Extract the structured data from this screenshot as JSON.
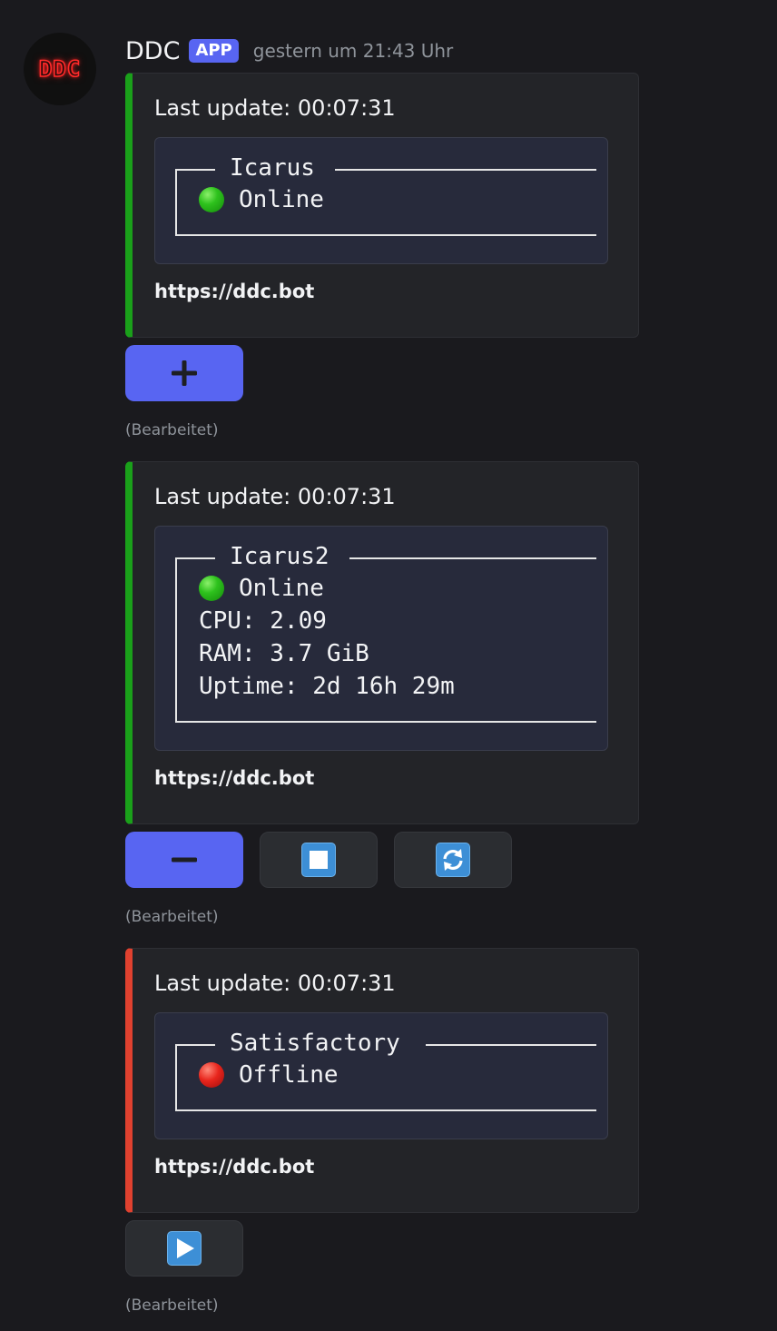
{
  "message": {
    "username": "DDC",
    "badge": "APP",
    "timestamp": "gestern um 21:43 Uhr",
    "avatar_text": "DDC"
  },
  "embeds": [
    {
      "title": "Last update: 00:07:31",
      "server_name": "Icarus",
      "status": "Online",
      "status_color": "#2ec21d",
      "stats": [],
      "footer": "https://ddc.bot",
      "accent_color": "#1aa01a",
      "buttons": [
        {
          "icon": "plus-icon",
          "style": "primary"
        }
      ],
      "edited": "(Bearbeitet)"
    },
    {
      "title": "Last update: 00:07:31",
      "server_name": "Icarus2",
      "status": "Online",
      "status_color": "#2ec21d",
      "stats": [
        "CPU: 2.09",
        "RAM: 3.7 GiB",
        "Uptime: 2d 16h 29m"
      ],
      "footer": "https://ddc.bot",
      "accent_color": "#1aa01a",
      "buttons": [
        {
          "icon": "minus-icon",
          "style": "primary"
        },
        {
          "icon": "stop-icon",
          "style": "secondary"
        },
        {
          "icon": "restart-icon",
          "style": "secondary"
        }
      ],
      "edited": "(Bearbeitet)"
    },
    {
      "title": "Last update: 00:07:31",
      "server_name": "Satisfactory",
      "status": "Offline",
      "status_color": "#e8251c",
      "stats": [],
      "footer": "https://ddc.bot",
      "accent_color": "#e0412f",
      "buttons": [
        {
          "icon": "play-icon",
          "style": "secondary"
        }
      ],
      "edited": "(Bearbeitet)"
    }
  ]
}
